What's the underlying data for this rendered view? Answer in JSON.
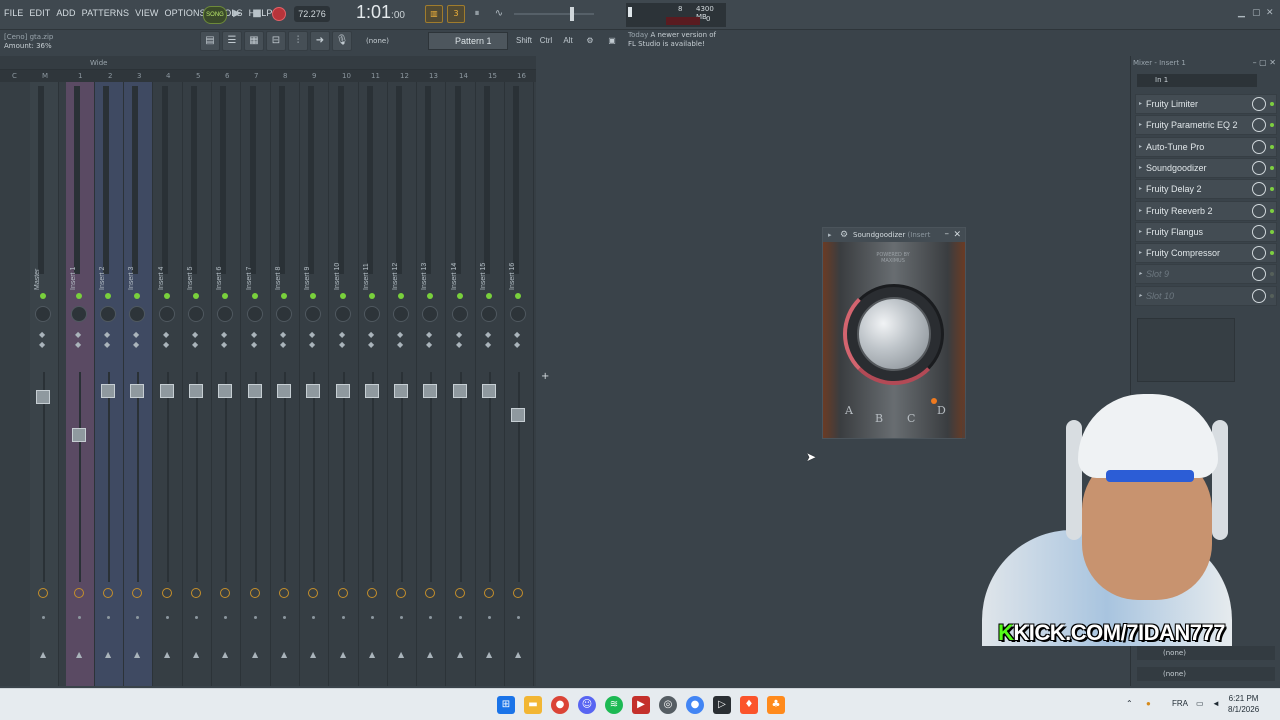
{
  "menu": [
    "FILE",
    "EDIT",
    "ADD",
    "PATTERNS",
    "VIEW",
    "OPTIONS",
    "TOOLS",
    "HELP"
  ],
  "hint": {
    "file": "[Ceno] gta.zip",
    "amount": "Amount: 36%"
  },
  "transport": {
    "song_label": "SONG",
    "tempo": "72.276",
    "time": "1:01",
    "time_small": ":00"
  },
  "cpu": {
    "poly": "8",
    "memory": "4300 MB",
    "zero": "0"
  },
  "toolbar": {
    "none_label": "(none)",
    "pattern": "Pattern 1",
    "shift": "Shift",
    "ctrl": "Ctrl",
    "alt": "Alt"
  },
  "news": {
    "today": "Today",
    "line1": "A newer version of",
    "line2": "FL Studio is available!"
  },
  "mixer": {
    "wide_label": "Wide",
    "ruler": [
      "C",
      "M",
      "1",
      "2",
      "3",
      "4",
      "5",
      "6",
      "7",
      "8",
      "9",
      "10",
      "11",
      "12",
      "13",
      "14",
      "15",
      "16"
    ],
    "strips": [
      "Master",
      "Insert 1",
      "Insert 2",
      "Insert 3",
      "Insert 4",
      "Insert 5",
      "Insert 6",
      "Insert 7",
      "Insert 8",
      "Insert 9",
      "Insert 10",
      "Insert 11",
      "Insert 12",
      "Insert 13",
      "Insert 14",
      "Insert 15",
      "Insert 16"
    ]
  },
  "plugin": {
    "title": "Soundgoodizer",
    "title_suffix": "(Insert",
    "brand": "POWERED BY MAXIMUS",
    "modes": [
      "A",
      "B",
      "C",
      "D"
    ]
  },
  "rpanel": {
    "title": "Mixer - Insert 1",
    "input": "In 1",
    "slots": [
      "Fruity Limiter",
      "Fruity Parametric EQ 2",
      "Auto-Tune Pro",
      "Soundgoodizer",
      "Fruity Delay 2",
      "Fruity Reeverb 2",
      "Fruity Flangus",
      "Fruity Compressor",
      "Slot 9",
      "Slot 10"
    ],
    "out1": "(none)",
    "out2": "(none)"
  },
  "stream": {
    "kick_k": "K",
    "kick_text": "KICK.COM/7IDAN777"
  },
  "taskbar": {
    "lang": "FRA",
    "time": "6:21 PM",
    "date": "8/1/2026"
  },
  "colors": {
    "accent_green": "#79d03c",
    "record_red": "#b8343a",
    "kick_green": "#53fc18"
  }
}
